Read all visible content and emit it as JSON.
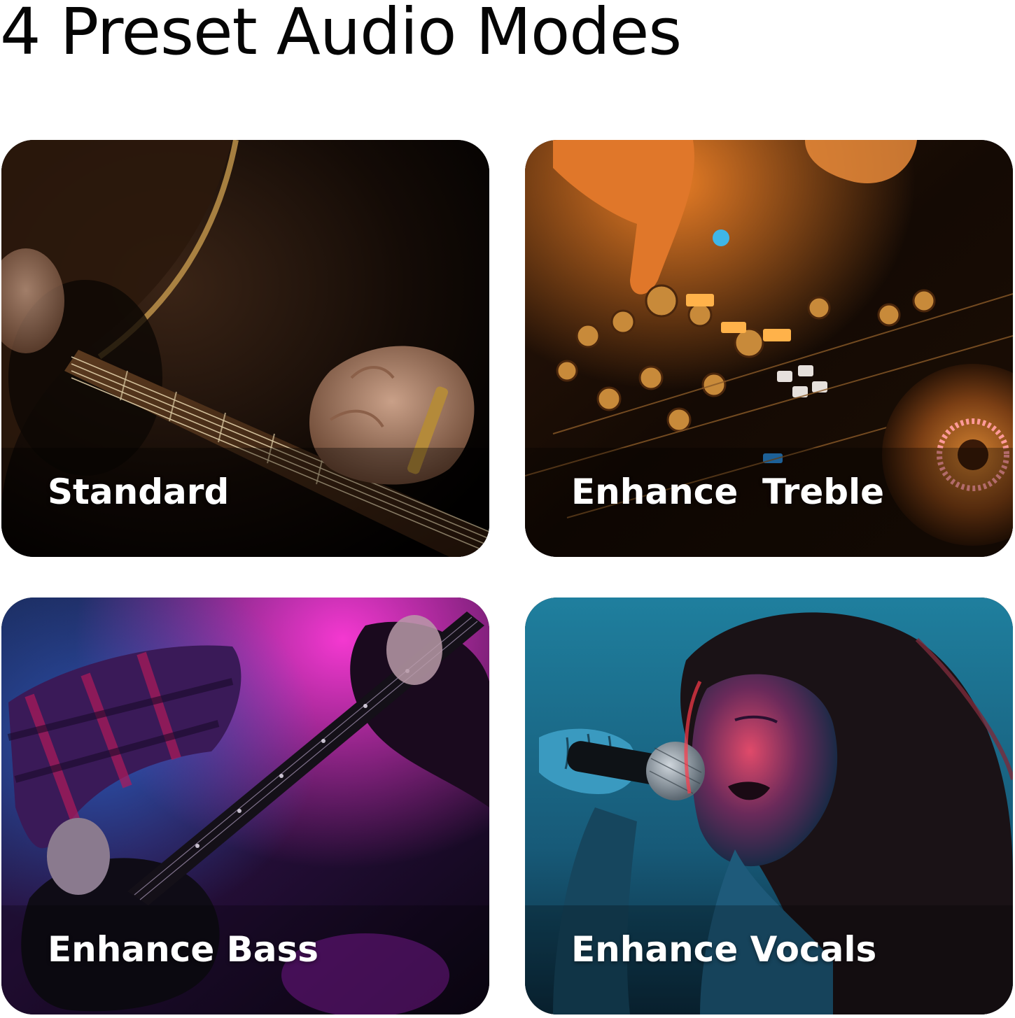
{
  "title": "4 Preset Audio Modes",
  "modes": [
    {
      "label": "Standard",
      "image": "acoustic-guitar-photo"
    },
    {
      "label": "Enhance  Treble",
      "image": "dj-mixer-photo"
    },
    {
      "label": "Enhance Bass",
      "image": "electric-guitarist-photo"
    },
    {
      "label": "Enhance Vocals",
      "image": "singer-with-microphone-photo"
    }
  ],
  "colors": {
    "background": "#ffffff",
    "title": "#050505",
    "label": "#ffffff",
    "treble_accent": "#f08a24",
    "bass_accent": "#e028c8",
    "vocals_accent": "#1f8fb0"
  }
}
